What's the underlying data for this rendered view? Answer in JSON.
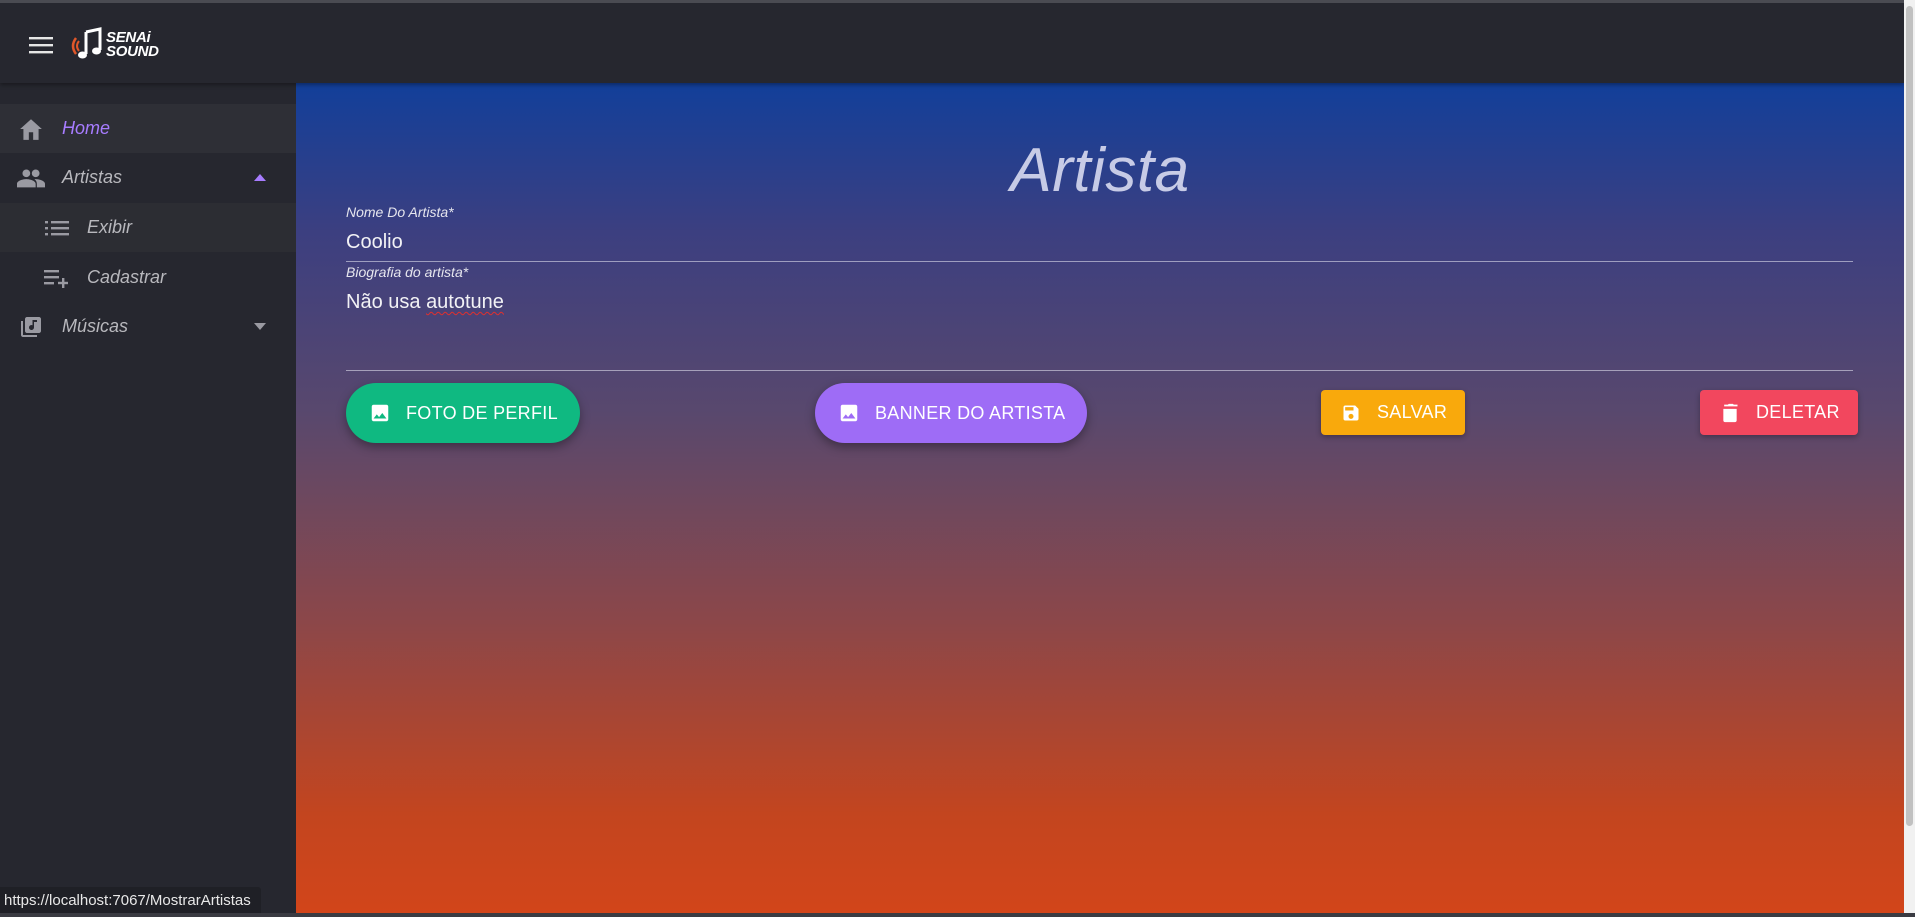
{
  "app": {
    "brand_line1": "SENAi",
    "brand_line2": "SOUND"
  },
  "colors": {
    "accent": "#a77cff",
    "green_button": "#0fb981",
    "purple_button": "#9e6cf6",
    "yellow_button": "#f9a90c",
    "red_button": "#f2475e"
  },
  "sidebar": {
    "items": [
      {
        "label": "Home",
        "icon": "home-icon"
      },
      {
        "label": "Artistas",
        "icon": "people-icon",
        "caret": "caret-up-icon"
      },
      {
        "label": "Exibir",
        "icon": "list-icon"
      },
      {
        "label": "Cadastrar",
        "icon": "playlist-add-icon"
      },
      {
        "label": "Músicas",
        "icon": "music-library-icon",
        "caret": "caret-down-icon"
      }
    ]
  },
  "main": {
    "title": "Artista",
    "name_label": "Nome Do Artista*",
    "name_value": "Coolio",
    "bio_label": "Biografia do artista*",
    "bio_value_prefix": "Não usa ",
    "bio_value_flagged": "autotune",
    "buttons": {
      "profile_photo": "FOTO DE PERFIL",
      "banner": "BANNER DO ARTISTA",
      "save": "SALVAR",
      "delete": "DELETAR"
    }
  },
  "status_bar": {
    "url": "https://localhost:7067/MostrarArtistas"
  }
}
